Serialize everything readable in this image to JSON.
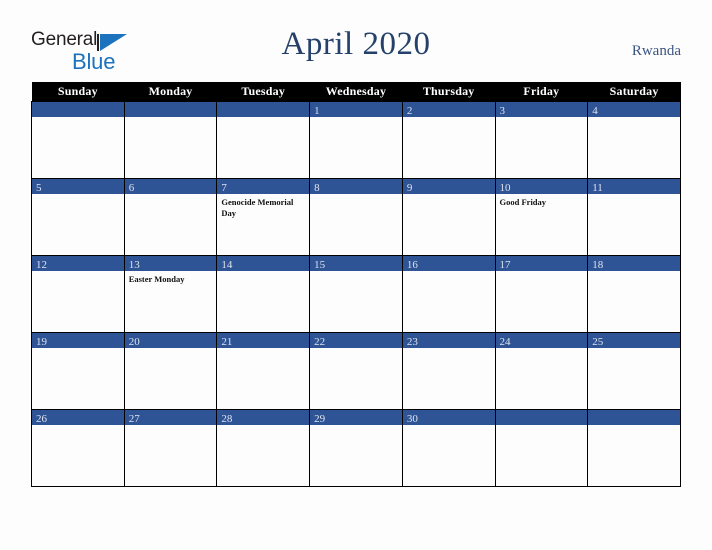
{
  "brand": {
    "name_part1": "General",
    "name_part2": "Blue",
    "triangle_color": "#1C72BD",
    "text_color": "#231F20"
  },
  "header": {
    "title": "April 2020",
    "country": "Rwanda",
    "title_color": "#25416B",
    "country_color": "#3B5480"
  },
  "calendar": {
    "month": "April",
    "year": "2020",
    "accent_color": "#2F5496",
    "header_bg": "#000000",
    "header_text_color": "#FFFFFF",
    "weekday_headers": [
      "Sunday",
      "Monday",
      "Tuesday",
      "Wednesday",
      "Thursday",
      "Friday",
      "Saturday"
    ],
    "weeks": [
      [
        {
          "day": "",
          "events": []
        },
        {
          "day": "",
          "events": []
        },
        {
          "day": "",
          "events": []
        },
        {
          "day": "1",
          "events": []
        },
        {
          "day": "2",
          "events": []
        },
        {
          "day": "3",
          "events": []
        },
        {
          "day": "4",
          "events": []
        }
      ],
      [
        {
          "day": "5",
          "events": []
        },
        {
          "day": "6",
          "events": []
        },
        {
          "day": "7",
          "events": [
            "Genocide Memorial Day"
          ]
        },
        {
          "day": "8",
          "events": []
        },
        {
          "day": "9",
          "events": []
        },
        {
          "day": "10",
          "events": [
            "Good Friday"
          ]
        },
        {
          "day": "11",
          "events": []
        }
      ],
      [
        {
          "day": "12",
          "events": []
        },
        {
          "day": "13",
          "events": [
            "Easter Monday"
          ]
        },
        {
          "day": "14",
          "events": []
        },
        {
          "day": "15",
          "events": []
        },
        {
          "day": "16",
          "events": []
        },
        {
          "day": "17",
          "events": []
        },
        {
          "day": "18",
          "events": []
        }
      ],
      [
        {
          "day": "19",
          "events": []
        },
        {
          "day": "20",
          "events": []
        },
        {
          "day": "21",
          "events": []
        },
        {
          "day": "22",
          "events": []
        },
        {
          "day": "23",
          "events": []
        },
        {
          "day": "24",
          "events": []
        },
        {
          "day": "25",
          "events": []
        }
      ],
      [
        {
          "day": "26",
          "events": []
        },
        {
          "day": "27",
          "events": []
        },
        {
          "day": "28",
          "events": []
        },
        {
          "day": "29",
          "events": []
        },
        {
          "day": "30",
          "events": []
        },
        {
          "day": "",
          "events": []
        },
        {
          "day": "",
          "events": []
        }
      ]
    ]
  }
}
